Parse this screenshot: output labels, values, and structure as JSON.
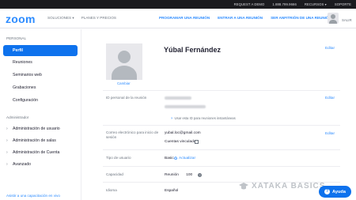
{
  "topbar": {
    "links": [
      "REQUEST A DEMO",
      "1.888.799.9666",
      "RECURSOS ▾",
      "SOPORTE"
    ]
  },
  "brand": {
    "logo": "zoom",
    "color": "#2d8cff"
  },
  "nav": {
    "left": [
      "SOLUCIONES ▾",
      "PLANES Y PRECIOS"
    ],
    "right": [
      "PROGRAMAR UNA REUNIÓN",
      "ENTRAR A UNA REUNIÓN",
      "SER ANFITRIÓN DE UNA REUNIÓN ▾"
    ],
    "signout": "SALIR"
  },
  "sidebar": {
    "personal_header": "PERSONAL",
    "personal_items": [
      "Perfil",
      "Reuniones",
      "Seminarios web",
      "Grabaciones",
      "Configuración"
    ],
    "admin_header": "Administrador",
    "admin_items": [
      "Administración de usuario",
      "Administración de salas",
      "Administración de Cuenta",
      "Avanzado"
    ],
    "footer_link": "Asistir a una capacitación en vivo",
    "active_color": "#0e72ed"
  },
  "profile": {
    "change_photo": "Cambiar",
    "name": "Yúbal Fernández",
    "edit": "Editar",
    "meeting_id_label": "ID personal de la reunión",
    "meeting_id_note": "Usar esta ID para reuniones instantáneas",
    "email_label": "Correo electrónico para inicio de sesión",
    "email_value": "yubal.loc@gmail.com",
    "linked_accounts_label": "Cuentas vinculadas:",
    "user_type_label": "Tipo de usuario",
    "user_type_value": "Basic",
    "upgrade_link": "Actualizar",
    "capacity_label": "Capacidad",
    "capacity_value": "Reunión 100",
    "language_label": "Idioma",
    "language_value": "Español"
  },
  "watermark": "XATAKA BASICS",
  "help": {
    "label": "Ayuda",
    "icon": "question-icon"
  }
}
